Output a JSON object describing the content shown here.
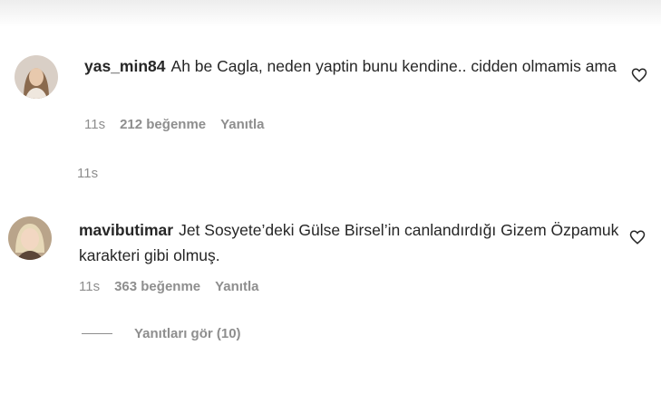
{
  "comments": [
    {
      "username": "yas_min84",
      "text": "Ah be Cagla, neden yaptin bunu kendine.. cidden olmamis ama",
      "time": "11s",
      "likes": "212 beğenme",
      "reply": "Yanıtla"
    },
    {
      "username": "mavibutimar",
      "text": "Jet Sosyete’deki Gülse Birsel’in canlandırdığı Gizem Özpamuk karakteri gibi olmuş.",
      "time": "11s",
      "likes": "363 beğenme",
      "reply": "Yanıtla"
    }
  ],
  "middle_timestamp": "11s",
  "view_replies": "Yanıtları gör (10)",
  "icons": {
    "like": "heart-outline-icon",
    "avatar_1": "avatar-photo",
    "avatar_2": "avatar-photo"
  }
}
